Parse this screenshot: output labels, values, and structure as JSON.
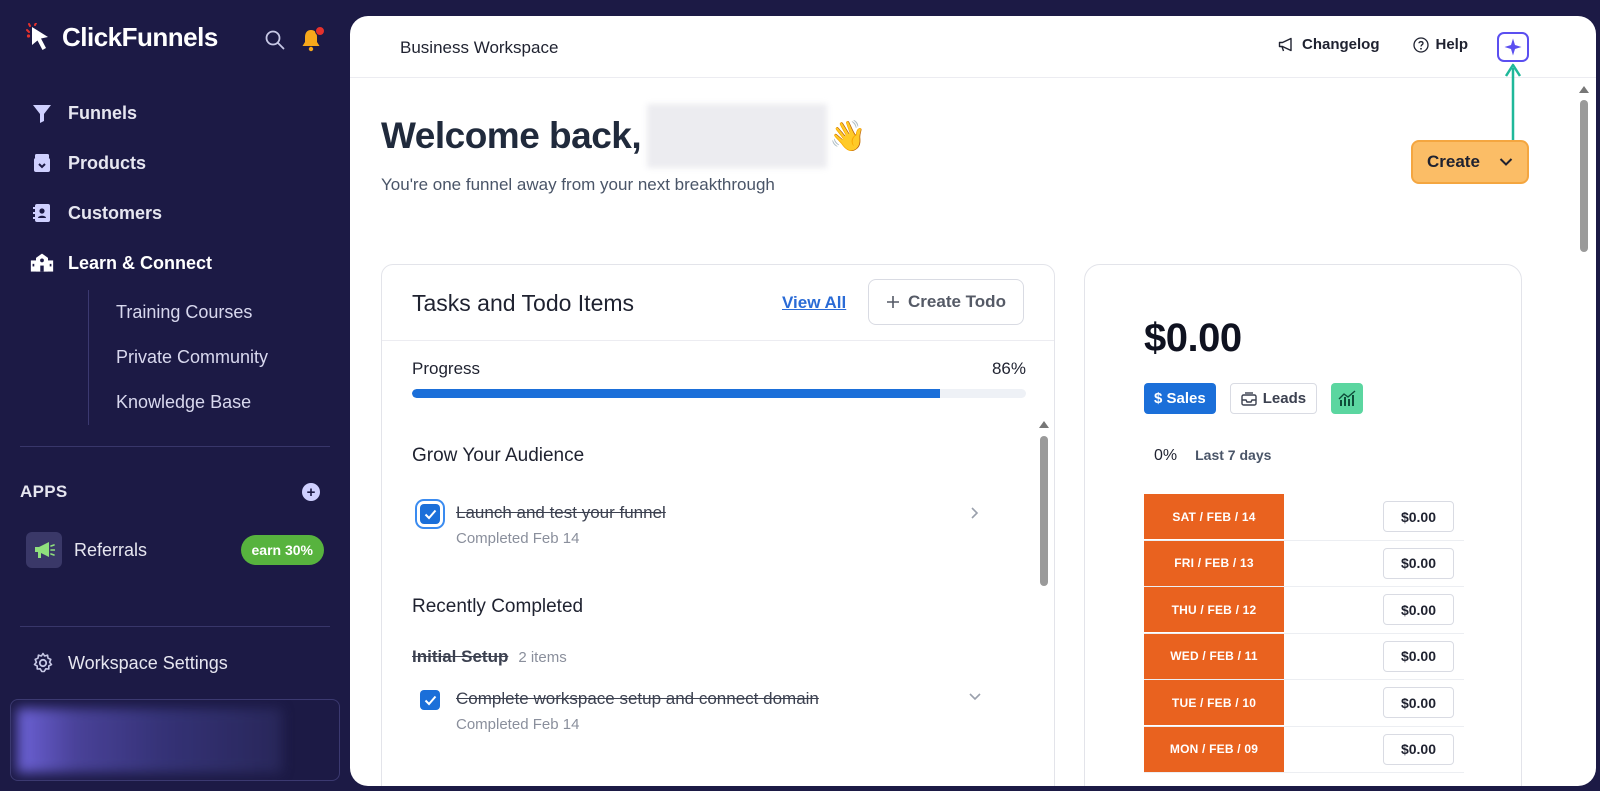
{
  "sidebar": {
    "brand": "ClickFunnels",
    "nav": [
      {
        "label": "Funnels",
        "icon": "funnel-icon"
      },
      {
        "label": "Products",
        "icon": "box-icon"
      },
      {
        "label": "Customers",
        "icon": "contacts-icon"
      },
      {
        "label": "Learn & Connect",
        "icon": "school-icon"
      }
    ],
    "sub_nav": [
      "Training Courses",
      "Private Community",
      "Knowledge Base"
    ],
    "apps_label": "APPS",
    "apps": [
      {
        "label": "Referrals",
        "badge": "earn 30%",
        "icon": "megaphone-icon"
      }
    ],
    "settings_label": "Workspace Settings"
  },
  "topbar": {
    "workspace": "Business Workspace",
    "changelog": "Changelog",
    "help": "Help"
  },
  "hero": {
    "welcome": "Welcome back,",
    "emoji": "👋",
    "tagline": "You're one funnel away from your next breakthrough",
    "create_label": "Create"
  },
  "tasks": {
    "title": "Tasks and Todo Items",
    "view_all": "View All",
    "create_todo": "Create Todo",
    "progress_label": "Progress",
    "progress_text": "86%",
    "progress_value": 86,
    "section1": "Grow Your Audience",
    "task1": {
      "title": "Launch and test your funnel",
      "meta": "Completed Feb 14"
    },
    "section2": "Recently Completed",
    "group": {
      "name": "Initial Setup",
      "count": "2 items"
    },
    "task2": {
      "title": "Complete workspace setup and connect domain",
      "meta": "Completed Feb 14"
    }
  },
  "sales": {
    "amount": "$0.00",
    "toggles": [
      "$ Sales",
      "Leads"
    ],
    "period_pct": "0%",
    "period_range": "Last 7 days",
    "rows": [
      {
        "day": "SAT / FEB / 14",
        "value": "$0.00"
      },
      {
        "day": "FRI / FEB / 13",
        "value": "$0.00"
      },
      {
        "day": "THU / FEB / 12",
        "value": "$0.00"
      },
      {
        "day": "WED / FEB / 11",
        "value": "$0.00"
      },
      {
        "day": "TUE / FEB / 10",
        "value": "$0.00"
      },
      {
        "day": "MON / FEB / 09",
        "value": "$0.00"
      }
    ]
  },
  "colors": {
    "sidebar_bg": "#1c1a45",
    "accent_blue": "#1b6fd9",
    "create_orange": "#fbbd66",
    "day_orange": "#e9621f",
    "earn_green": "#57b33e",
    "annotation_arrow": "#1fb89a"
  }
}
